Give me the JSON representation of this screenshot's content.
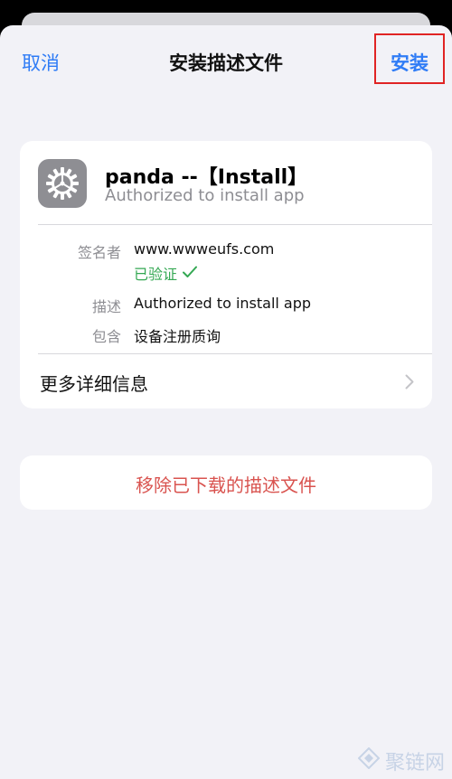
{
  "nav": {
    "cancel_label": "取消",
    "title": "安装描述文件",
    "install_label": "安装"
  },
  "profile": {
    "name": "panda --【Install】",
    "subtitle": "Authorized to install app",
    "icon": "gear-icon",
    "details": {
      "signer_label": "签名者",
      "signer_value": "www.wwweufs.com",
      "verified_text": "已验证",
      "description_label": "描述",
      "description_value": "Authorized to install app",
      "contains_label": "包含",
      "contains_value": "设备注册质询"
    },
    "more_label": "更多详细信息"
  },
  "remove_label": "移除已下载的描述文件",
  "watermark": {
    "text": "聚链网",
    "icon": "diamond-logo-icon"
  },
  "colors": {
    "accent": "#2f7cf6",
    "highlight_box": "#e02424",
    "verified": "#34a853",
    "destructive": "#d9534f",
    "background": "#f2f2f7"
  }
}
